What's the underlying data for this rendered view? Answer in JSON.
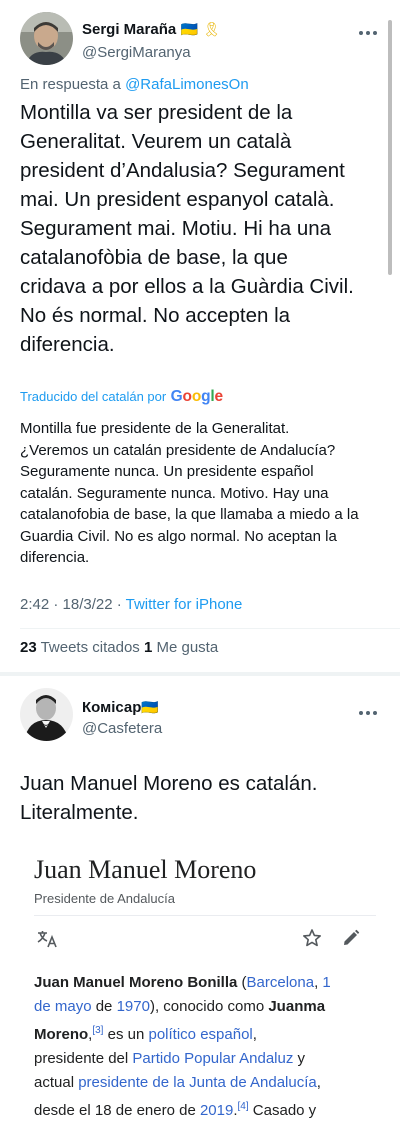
{
  "tweet1": {
    "author": {
      "name": "Sergi Maraña",
      "flag": "🇺🇦",
      "ribbon": "🎗",
      "handle": "@SergiMaranya"
    },
    "reply_prefix": "En respuesta a ",
    "reply_to": "@RafaLimonesOn",
    "text_lines": [
      "Montilla va ser president de la",
      "Generalitat. Veurem un català",
      "president d’Andalusia? Segurament",
      "mai. Un president espanyol català.",
      "Segurament mai. Motiu. Hi ha una",
      "catalanofòbia de base, la que",
      "cridava a por ellos a la Guàrdia Civil.",
      "No és normal. No accepten la",
      "diferencia."
    ],
    "translated_label": "Traducido del catalán por",
    "google": [
      "G",
      "o",
      "o",
      "g",
      "l",
      "e"
    ],
    "translation_lines": [
      "Montilla fue presidente de la Generalitat.",
      "¿Veremos un catalán presidente de Andalucía?",
      "Seguramente nunca. Un presidente español",
      "catalán. Seguramente nunca. Motivo. Hay una",
      "catalanofobia de base, la que llamaba a miedo a la",
      "Guardia Civil. No es algo normal. No aceptan la",
      "diferencia."
    ],
    "time": "2:42 · 18/3/22 · ",
    "source": "Twitter for iPhone",
    "quotes_count": "23",
    "quotes_label": " Tweets citados ",
    "likes_count": "1",
    "likes_label": " Me gusta"
  },
  "tweet2": {
    "author": {
      "name": "Комісар",
      "flag": "🇺🇦",
      "handle": "@Casfetera"
    },
    "text_lines": [
      "Juan Manuel Moreno es catalán.",
      "Literalmente."
    ],
    "embed": {
      "title": "Juan Manuel Moreno",
      "subtitle": "Presidente de Andalucía",
      "t1": "Juan Manuel Moreno Bonilla",
      "t2": " (",
      "t3": "Barcelona",
      "t4": ", ",
      "t5": "1",
      "t6": "de mayo",
      "t7": " de ",
      "t8": "1970",
      "t9": "), conocido como ",
      "t10": "Juanma",
      "t11": "Moreno",
      "t12": ",",
      "t13": "[3]",
      "t14": " es un ",
      "t15": "político español",
      "t16": ",",
      "t17": "presidente del ",
      "t18": "Partido Popular Andaluz",
      "t19": " y",
      "t20": "actual ",
      "t21": "presidente de la Junta de Andalucía",
      "t22": ",",
      "t23": "desde el 18 de enero de ",
      "t24": "2019",
      "t25": ".",
      "t26": "[4]",
      "t27": "  Casado y"
    }
  },
  "icons": {
    "more": "more-horizontal-icon",
    "translate": "translate-icon",
    "star": "star-icon",
    "edit": "pencil-icon"
  },
  "colors": {
    "link": "#1d9bf0",
    "secondary_text": "#536471",
    "wiki_link": "#3366cc",
    "google": [
      "#4285F4",
      "#EA4335",
      "#FBBC05",
      "#4285F4",
      "#34A853",
      "#EA4335"
    ]
  }
}
